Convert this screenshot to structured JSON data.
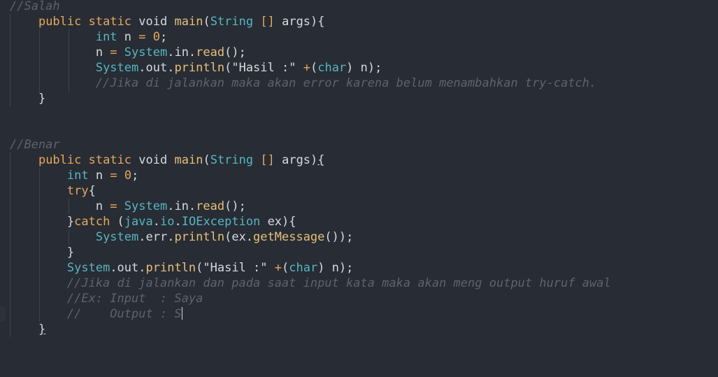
{
  "editor": {
    "background": "#282c34",
    "colors": {
      "comment": "#5c6370",
      "keyword": "#e5a85c",
      "type": "#56b6c2",
      "function": "#e6c07b",
      "plain": "#d7dae0"
    },
    "lines": [
      {
        "id": "l1",
        "text": "//Salah"
      },
      {
        "id": "l2",
        "text": "    public static void main(String [] args){"
      },
      {
        "id": "l3",
        "text": "            int n = 0;"
      },
      {
        "id": "l4",
        "text": "            n = System.in.read();"
      },
      {
        "id": "l5",
        "text": "            System.out.println(\"Hasil :\" +(char) n);"
      },
      {
        "id": "l6",
        "text": "            //Jika di jalankan maka akan error karena belum menambahkan try-catch."
      },
      {
        "id": "l7",
        "text": "    }"
      },
      {
        "id": "l8",
        "text": ""
      },
      {
        "id": "l9",
        "text": ""
      },
      {
        "id": "l10",
        "text": "//Benar"
      },
      {
        "id": "l11",
        "text": "    public static void main(String [] args){"
      },
      {
        "id": "l12",
        "text": "        int n = 0;"
      },
      {
        "id": "l13",
        "text": "        try{"
      },
      {
        "id": "l14",
        "text": "            n = System.in.read();"
      },
      {
        "id": "l15",
        "text": "        }catch (java.io.IOException ex){"
      },
      {
        "id": "l16",
        "text": "            System.err.println(ex.getMessage());"
      },
      {
        "id": "l17",
        "text": "        }"
      },
      {
        "id": "l18",
        "text": "        System.out.println(\"Hasil :\" +(char) n);"
      },
      {
        "id": "l19",
        "text": "        //Jika di jalankan dan pada saat input kata maka akan meng output huruf awal"
      },
      {
        "id": "l20",
        "text": "        //Ex: Input  : Saya"
      },
      {
        "id": "l21",
        "text": "        //    Output : S"
      },
      {
        "id": "l22",
        "text": "    }"
      }
    ]
  }
}
